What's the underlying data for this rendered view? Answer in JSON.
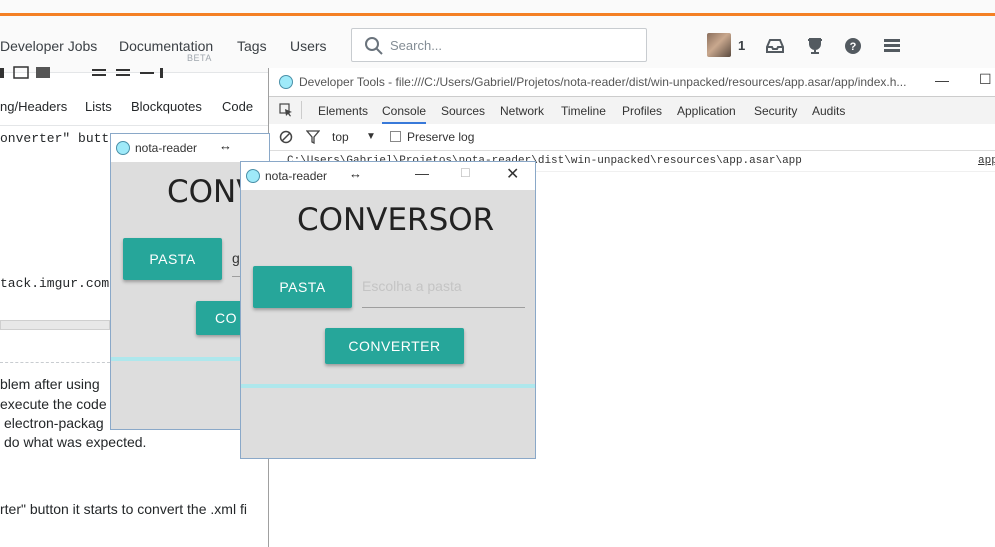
{
  "so": {
    "nav": [
      "Developer Jobs",
      "Documentation",
      "Tags",
      "Users"
    ],
    "nav_beta": "BETA",
    "search_placeholder": "Search...",
    "reputation": "1",
    "editor_tabs": [
      "ng/Headers",
      "Lists",
      "Blockquotes",
      "Code"
    ],
    "fragments": {
      "converter_button": "onverter\" butto",
      "imgur": "tack.imgur.com/",
      "problem_after": "blem after using",
      "execute": "execute the code",
      "electron": "electron-packag",
      "expected": "do what was expected.",
      "last_line": "rter\" button it starts to convert the .xml fi"
    }
  },
  "devtools": {
    "title": "Developer Tools - file:///C:/Users/Gabriel/Projetos/nota-reader/dist/win-unpacked/resources/app.asar/app/index.h...",
    "tabs": [
      "Elements",
      "Console",
      "Sources",
      "Network",
      "Timeline",
      "Profiles",
      "Application",
      "Security",
      "Audits"
    ],
    "active_tab": "Console",
    "context": "top",
    "preserve_log": "Preserve log",
    "log_line": "C:\\Users\\Gabriel\\Projetos\\nota-reader\\dist\\win-unpacked\\resources\\app.asar\\app",
    "log_source": "app"
  },
  "app_back": {
    "title": "nota-reader",
    "heading": "CONV",
    "pasta_button": "PASTA",
    "field_fragment": "g",
    "convert_fragment": "CO"
  },
  "app_front": {
    "title": "nota-reader",
    "heading": "CONVERSOR",
    "pasta_button": "PASTA",
    "field_placeholder": "Escolha a pasta",
    "convert_button": "CONVERTER"
  },
  "colors": {
    "accent": "#26a69a",
    "so_orange": "#f48024",
    "divider": "#aee7ec"
  }
}
